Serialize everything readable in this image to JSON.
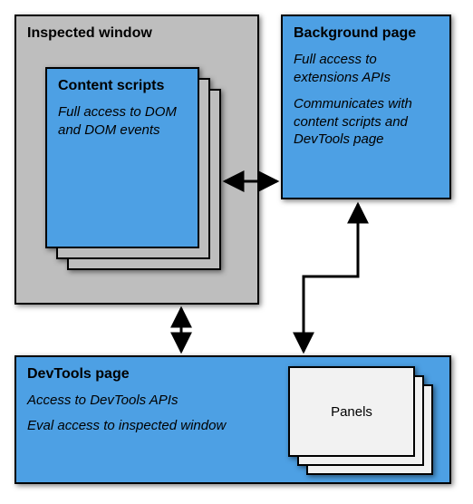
{
  "inspected_window": {
    "title": "Inspected window"
  },
  "content_scripts": {
    "title": "Content scripts",
    "desc": "Full access to DOM and DOM events"
  },
  "background_page": {
    "title": "Background page",
    "desc1": "Full access to extensions APIs",
    "desc2": "Communicates with content scripts and DevTools page"
  },
  "devtools_page": {
    "title": "DevTools page",
    "desc1": "Access to DevTools APIs",
    "desc2": "Eval access to inspected window"
  },
  "panels": {
    "label": "Panels"
  },
  "connections": [
    {
      "from": "content_scripts",
      "to": "background_page",
      "bidirectional": true
    },
    {
      "from": "background_page",
      "to": "devtools_page",
      "bidirectional": true
    },
    {
      "from": "inspected_window",
      "to": "devtools_page",
      "bidirectional": true
    }
  ]
}
